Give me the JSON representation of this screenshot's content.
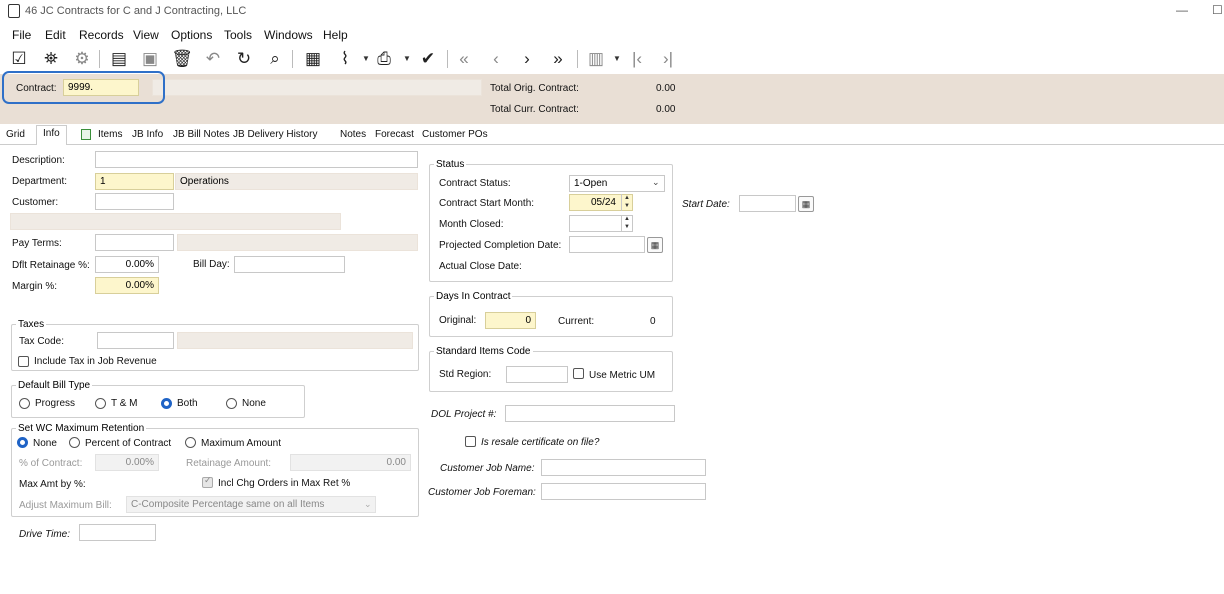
{
  "window": {
    "title": "46 JC Contracts for C and J Contracting, LLC",
    "minimize": "—",
    "maximize": "☐"
  },
  "menu": [
    "File",
    "Edit",
    "Records",
    "View",
    "Options",
    "Tools",
    "Windows",
    "Help"
  ],
  "header": {
    "contract_label": "Contract:",
    "contract_value": "9999.",
    "total_orig_label": "Total Orig. Contract:",
    "total_orig_value": "0.00",
    "total_curr_label": "Total Curr. Contract:",
    "total_curr_value": "0.00"
  },
  "tabs": [
    "Grid",
    "Info",
    "Items",
    "JB Info",
    "JB Bill Notes",
    "JB Delivery History",
    "Notes",
    "Forecast",
    "Customer POs"
  ],
  "info": {
    "description_label": "Description:",
    "department_label": "Department:",
    "department_value": "1",
    "department_name": "Operations",
    "customer_label": "Customer:",
    "pay_terms_label": "Pay Terms:",
    "dflt_retainage_label": "Dflt Retainage %:",
    "dflt_retainage_value": "0.00%",
    "bill_day_label": "Bill Day:",
    "margin_label": "Margin %:",
    "margin_value": "0.00%"
  },
  "taxes": {
    "title": "Taxes",
    "tax_code_label": "Tax Code:",
    "include_tax_label": "Include Tax in Job Revenue"
  },
  "default_bill_type": {
    "title": "Default Bill Type",
    "options": [
      "Progress",
      "T & M",
      "Both",
      "None"
    ],
    "selected": "Both"
  },
  "wc_retention": {
    "title": "Set WC Maximum Retention",
    "options": [
      "None",
      "Percent of Contract",
      "Maximum Amount"
    ],
    "selected": "None",
    "pct_contract_label": "% of Contract:",
    "pct_contract_value": "0.00%",
    "retainage_amount_label": "Retainage Amount:",
    "retainage_amount_value": "0.00",
    "max_amt_label": "Max Amt by %:",
    "incl_chg_label": "Incl Chg Orders in Max Ret %",
    "adjust_max_label": "Adjust Maximum Bill:",
    "adjust_max_value": "C-Composite Percentage same on all Items"
  },
  "drive_time_label": "Drive Time:",
  "status": {
    "title": "Status",
    "contract_status_label": "Contract Status:",
    "contract_status_value": "1-Open",
    "start_month_label": "Contract Start Month:",
    "start_month_value": "05/24",
    "month_closed_label": "Month Closed:",
    "projected_label": "Projected Completion Date:",
    "actual_close_label": "Actual Close Date:"
  },
  "start_date_label": "Start Date:",
  "days": {
    "title": "Days In Contract",
    "original_label": "Original:",
    "original_value": "0",
    "current_label": "Current:",
    "current_value": "0"
  },
  "std_items": {
    "title": "Standard Items Code",
    "std_region_label": "Std Region:",
    "metric_label": "Use Metric UM"
  },
  "dol_label": "DOL Project #:",
  "resale_label": "Is resale certificate on file?",
  "customer_job_name_label": "Customer Job Name:",
  "customer_job_foreman_label": "Customer Job Foreman:"
}
